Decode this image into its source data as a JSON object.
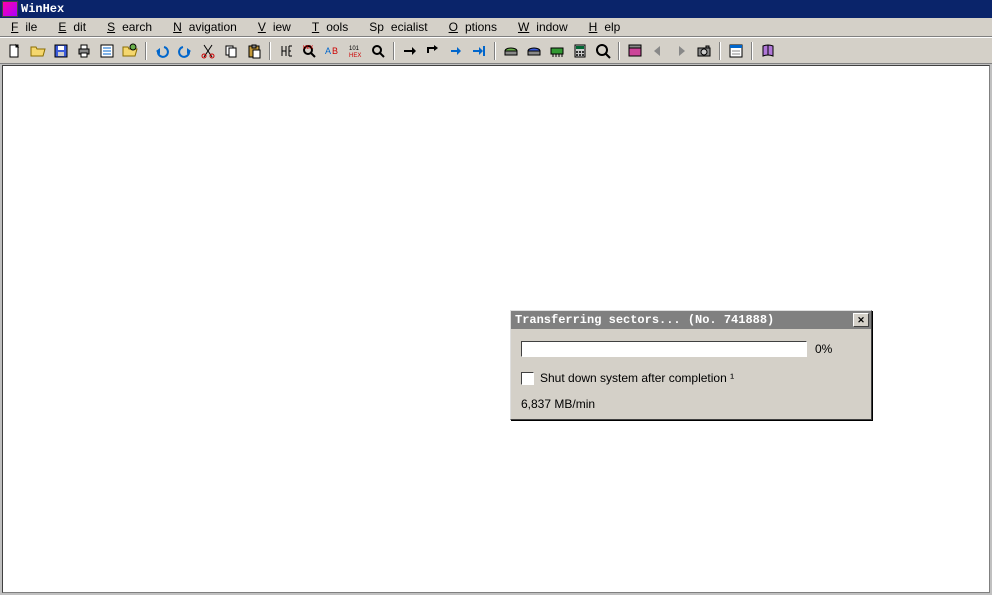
{
  "app": {
    "title": "WinHex"
  },
  "menu": {
    "file": "File",
    "edit": "Edit",
    "search": "Search",
    "navigation": "Navigation",
    "view": "View",
    "tools": "Tools",
    "specialist": "Specialist",
    "options": "Options",
    "window": "Window",
    "help": "Help"
  },
  "dialog": {
    "title": "Transferring sectors... (No. 741888)",
    "percent": "0%",
    "checkbox_label": "Shut down system after completion ¹",
    "rate": "6,837 MB/min"
  },
  "toolbar_icons": [
    "new-file-icon",
    "open-folder-icon",
    "save-icon",
    "print-icon",
    "properties-icon",
    "open-disk-icon",
    "sep",
    "undo-icon",
    "redo-icon",
    "cut-icon",
    "copy-icon",
    "paste-icon",
    "sep",
    "find-icon",
    "find-hex-icon",
    "find-text-icon",
    "replace-icon",
    "goto-icon",
    "sep",
    "arrow-right-icon",
    "arrow-turn-icon",
    "arrow-up-icon",
    "arrow-last-icon",
    "sep",
    "disk-green-icon",
    "disk-blue-icon",
    "ram-icon",
    "calculator-icon",
    "analyze-icon",
    "sep",
    "template-icon",
    "back-icon",
    "forward-icon",
    "camera-icon",
    "sep",
    "options-icon",
    "sep",
    "help-book-icon"
  ]
}
